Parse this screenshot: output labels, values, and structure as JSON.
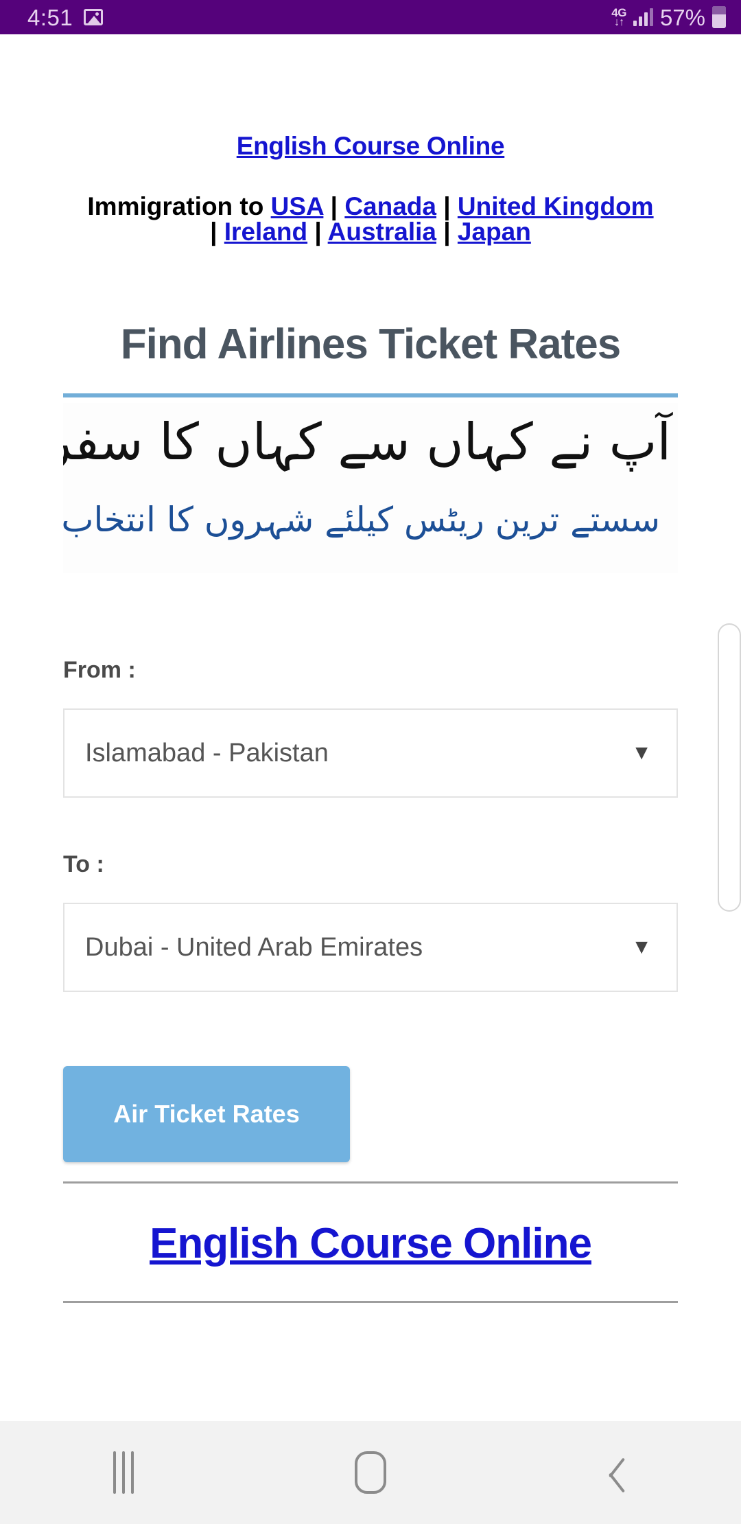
{
  "status_bar": {
    "time": "4:51",
    "image_icon": "picture-icon",
    "network_type": "4G",
    "data_arrows": "↓↑",
    "signal_icon": "signal-bars-icon",
    "battery_percent": "57%",
    "battery_icon": "battery-icon",
    "background_color": "#55027b"
  },
  "page": {
    "top_link": "English Course Online",
    "immigration": {
      "prefix": "Immigration to ",
      "separator": " | ",
      "countries": [
        "USA",
        "Canada",
        "United Kingdom",
        "Ireland",
        "Australia",
        "Japan"
      ]
    },
    "title": "Find Airlines Ticket Rates",
    "accent_color": "#72aed8",
    "banner": {
      "line1": "آپ نے کہاں سے کہاں کا سفر کرنا ہے؟",
      "line2": "سستے ترین ریٹس کیلئے شہروں کا انتخاب کریں"
    },
    "form": {
      "from_label": "From :",
      "from_value": "Islamabad - Pakistan",
      "to_label": "To :",
      "to_value": "Dubai - United Arab Emirates",
      "dropdown_arrow": "▼",
      "submit_label": "Air Ticket Rates",
      "submit_color": "#71b2e0"
    },
    "bottom_link": "English Course Online"
  },
  "nav_bar": {
    "recents": "recent-apps-icon",
    "home": "home-icon",
    "back": "back-icon"
  }
}
